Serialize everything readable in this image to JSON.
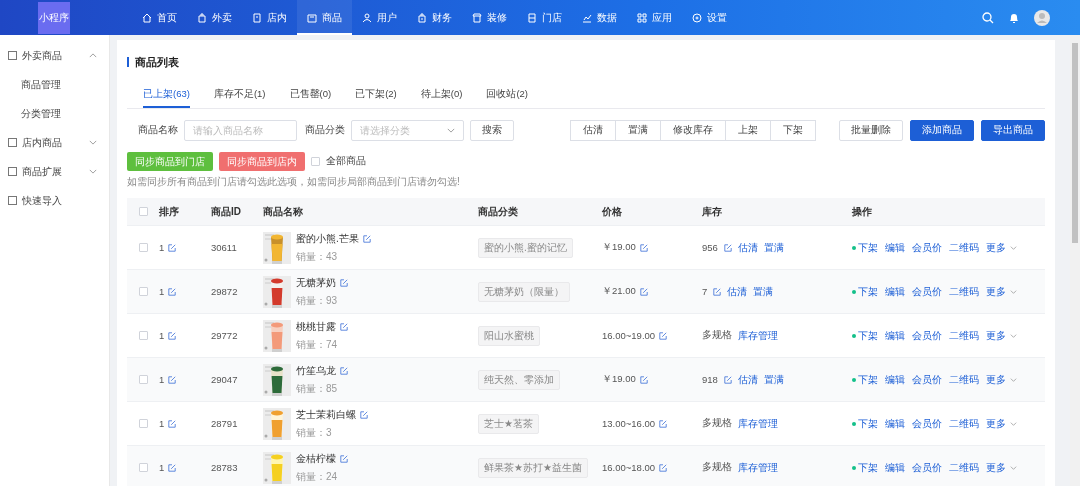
{
  "logo": "小程序",
  "nav": [
    {
      "label": "首页",
      "selected": false
    },
    {
      "label": "外卖",
      "selected": false
    },
    {
      "label": "店内",
      "selected": false
    },
    {
      "label": "商品",
      "selected": true
    },
    {
      "label": "用户",
      "selected": false
    },
    {
      "label": "财务",
      "selected": false
    },
    {
      "label": "装修",
      "selected": false
    },
    {
      "label": "门店",
      "selected": false
    },
    {
      "label": "数据",
      "selected": false
    },
    {
      "label": "应用",
      "selected": false
    },
    {
      "label": "设置",
      "selected": false
    }
  ],
  "sidebar": {
    "items": [
      {
        "label": "外卖商品",
        "expanded": true,
        "children": [
          {
            "label": "商品管理"
          },
          {
            "label": "分类管理"
          }
        ]
      },
      {
        "label": "店内商品",
        "expanded": false
      },
      {
        "label": "商品扩展",
        "expanded": false
      },
      {
        "label": "快速导入"
      }
    ]
  },
  "page_title": "商品列表",
  "tabs": [
    {
      "label": "已上架(63)",
      "selected": true
    },
    {
      "label": "库存不足(1)",
      "selected": false
    },
    {
      "label": "已售罄(0)",
      "selected": false
    },
    {
      "label": "已下架(2)",
      "selected": false
    },
    {
      "label": "待上架(0)",
      "selected": false
    },
    {
      "label": "回收站(2)",
      "selected": false
    }
  ],
  "filters": {
    "name_label": "商品名称",
    "name_placeholder": "请输入商品名称",
    "category_label": "商品分类",
    "category_placeholder": "请选择分类",
    "search_button": "搜索"
  },
  "batch_buttons": [
    "估清",
    "置满",
    "修改库存",
    "上架",
    "下架"
  ],
  "action_buttons": [
    {
      "label": "批量删除",
      "kind": "plain"
    },
    {
      "label": "添加商品",
      "kind": "primary"
    },
    {
      "label": "导出商品",
      "kind": "primary"
    }
  ],
  "sync": {
    "to_stores": "同步商品到门店",
    "to_shop": "同步商品到店内",
    "all_label": "全部商品",
    "all_checked": false,
    "hint": "如需同步所有商品到门店请勾选此选项，如需同步局部商品到门店请勿勾选!"
  },
  "table": {
    "select_all": false,
    "columns": [
      "排序",
      "商品ID",
      "商品名称",
      "商品分类",
      "价格",
      "库存",
      "操作"
    ],
    "rows": [
      {
        "checked": false,
        "sort": "1",
        "id": "30611",
        "name": "蜜的小熊.芒果",
        "sales": "销量：43",
        "category": "蜜的小熊.蜜的记忆",
        "price": "￥19.00",
        "kind": "single",
        "stock": "956",
        "stock_actions": [
          "估清",
          "置满"
        ],
        "ops": [
          "下架",
          "编辑",
          "会员价",
          "二维码",
          "更多"
        ]
      },
      {
        "checked": false,
        "sort": "1",
        "id": "29872",
        "name": "无糖茅奶",
        "sales": "销量：93",
        "category": "无糖茅奶（限量）",
        "price": "￥21.00",
        "kind": "single",
        "stock": "7",
        "stock_actions": [
          "估清",
          "置满"
        ],
        "ops": [
          "下架",
          "编辑",
          "会员价",
          "二维码",
          "更多"
        ]
      },
      {
        "checked": false,
        "sort": "1",
        "id": "29772",
        "name": "桃桃甘露",
        "sales": "销量：74",
        "category": "阳山水蜜桃",
        "price": "16.00~19.00",
        "kind": "multi",
        "stock": "多规格",
        "stock_actions": [
          "库存管理"
        ],
        "ops": [
          "下架",
          "编辑",
          "会员价",
          "二维码",
          "更多"
        ]
      },
      {
        "checked": false,
        "sort": "1",
        "id": "29047",
        "name": "竹笙乌龙",
        "sales": "销量：85",
        "category": "纯天然、零添加",
        "price": "￥19.00",
        "kind": "single",
        "stock": "918",
        "stock_actions": [
          "估清",
          "置满"
        ],
        "ops": [
          "下架",
          "编辑",
          "会员价",
          "二维码",
          "更多"
        ]
      },
      {
        "checked": false,
        "sort": "1",
        "id": "28791",
        "name": "芝士茉莉白螺",
        "sales": "销量：3",
        "category": "芝士★茗茶",
        "price": "13.00~16.00",
        "kind": "multi",
        "stock": "多规格",
        "stock_actions": [
          "库存管理"
        ],
        "ops": [
          "下架",
          "编辑",
          "会员价",
          "二维码",
          "更多"
        ]
      },
      {
        "checked": false,
        "sort": "1",
        "id": "28783",
        "name": "金桔柠檬",
        "sales": "销量：24",
        "category": "鲜果茶★苏打★益生菌",
        "price": "16.00~18.00",
        "kind": "multi",
        "stock": "多规格",
        "stock_actions": [
          "库存管理"
        ],
        "ops": [
          "下架",
          "编辑",
          "会员价",
          "二维码",
          "更多"
        ]
      }
    ]
  }
}
